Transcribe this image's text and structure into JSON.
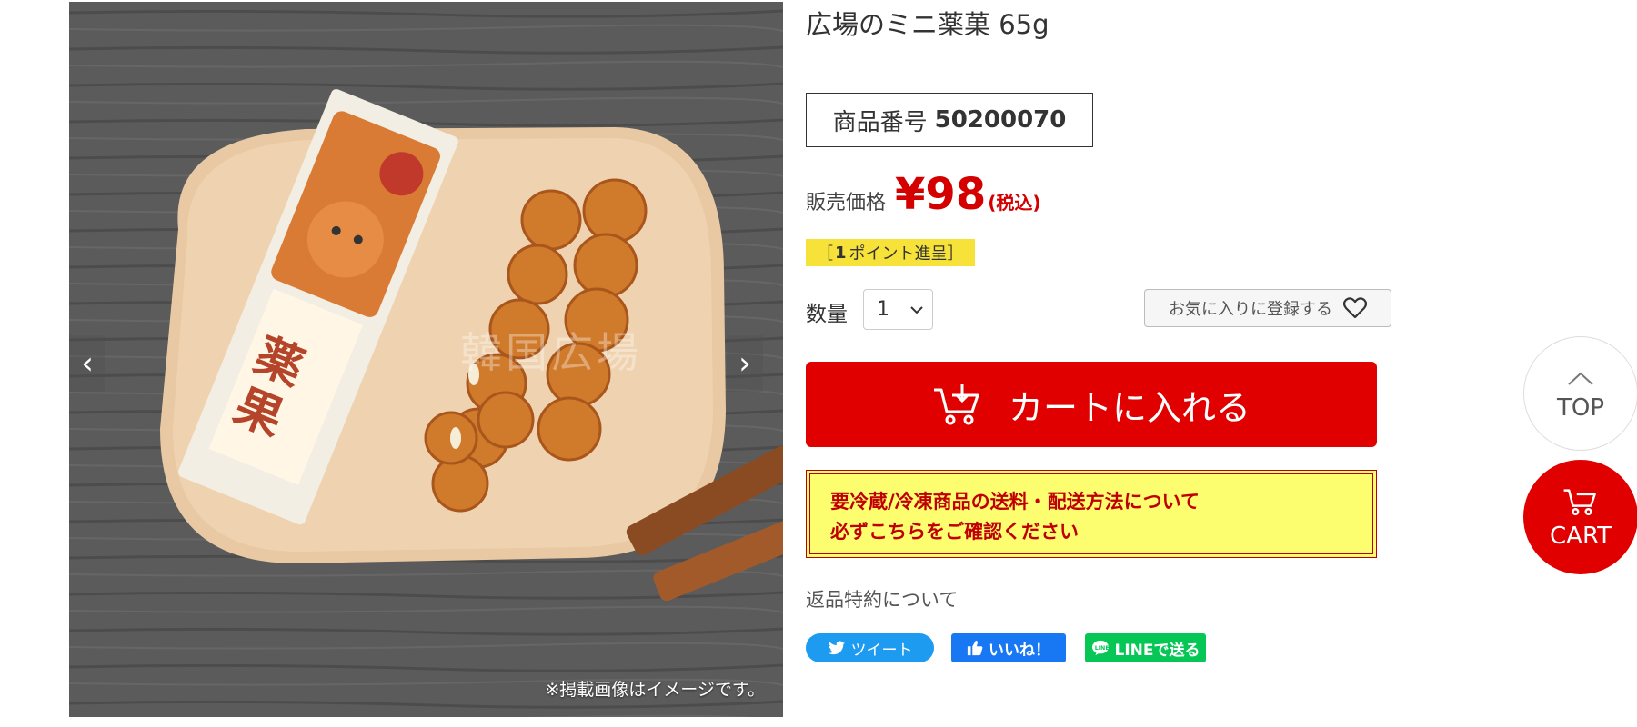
{
  "product": {
    "title": "広場のミニ薬菓 65g",
    "sku_label": "商品番号",
    "sku_number": "50200070",
    "price_label": "販売価格",
    "price_value": "¥98",
    "price_tax": "(税込)",
    "point_open": "［",
    "point_count": "1",
    "point_text": "ポイント進呈",
    "point_close": "］"
  },
  "gallery": {
    "watermark": "韓国広場",
    "note": "※掲載画像はイメージです。",
    "prev_icon": "chevron-left-icon",
    "next_icon": "chevron-right-icon"
  },
  "quantity": {
    "label": "数量",
    "selected": "1"
  },
  "favorite": {
    "label": "お気に入りに登録する",
    "icon": "heart-icon"
  },
  "cart": {
    "label": "カートに入れる",
    "icon": "cart-icon"
  },
  "notice": {
    "line1": "要冷蔵/冷凍商品の送料・配送方法について",
    "line2": "必ずこちらをご確認ください"
  },
  "return_link": "返品特約について",
  "share": {
    "tweet": "ツイート",
    "like": "いいね！",
    "line": "LINEで送る"
  },
  "floating": {
    "top": "TOP",
    "cart": "CART"
  },
  "colors": {
    "accent_red": "#e00000",
    "price_red": "#d40000",
    "point_yellow": "#f7e23a",
    "notice_yellow": "#fdfd70",
    "twitter_blue": "#1d9bf0",
    "facebook_blue": "#1877f2",
    "line_green": "#06c755"
  }
}
